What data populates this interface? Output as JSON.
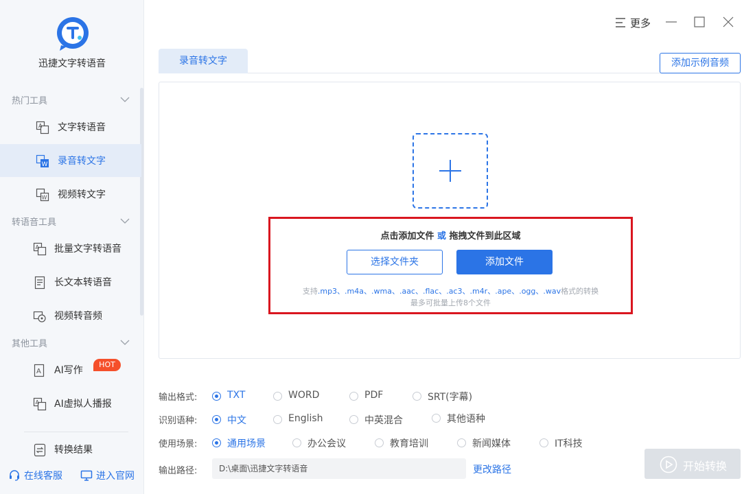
{
  "app": {
    "title": "迅捷文字转语音"
  },
  "titlebar": {
    "more_label": "更多"
  },
  "sidebar": {
    "sections": [
      {
        "title": "热门工具",
        "items": [
          {
            "label": "文字转语音",
            "icon": "text-to-speech-icon"
          },
          {
            "label": "录音转文字",
            "icon": "audio-to-text-icon",
            "active": true
          },
          {
            "label": "视频转文字",
            "icon": "video-to-text-icon"
          }
        ]
      },
      {
        "title": "转语音工具",
        "items": [
          {
            "label": "批量文字转语音",
            "icon": "batch-text-icon"
          },
          {
            "label": "长文本转语音",
            "icon": "long-text-icon"
          },
          {
            "label": "视频转音频",
            "icon": "video-audio-icon"
          }
        ]
      },
      {
        "title": "其他工具",
        "items": [
          {
            "label": "AI写作",
            "icon": "ai-write-icon",
            "badge": "HOT"
          },
          {
            "label": "AI虚拟人播报",
            "icon": "ai-avatar-icon"
          }
        ]
      }
    ],
    "result_item": {
      "label": "转换结果"
    },
    "footer": {
      "service": "在线客服",
      "website": "进入官网"
    }
  },
  "main": {
    "tab": "录音转文字",
    "sample_button": "添加示例音频",
    "drop": {
      "hint_a": "点击添加文件",
      "hint_or": "或",
      "hint_b": "拖拽文件到此区域",
      "folder_button": "选择文件夹",
      "add_button": "添加文件",
      "formats_prefix": "支持",
      "formats": ".mp3、.m4a、.wma、.aac、.flac、.ac3、.m4r、.ape、.ogg、.wav",
      "formats_suffix": "格式的转换",
      "limit": "最多可批量上传8个文件"
    },
    "options": {
      "format": {
        "label": "输出格式:",
        "choices": [
          "TXT",
          "WORD",
          "PDF",
          "SRT(字幕)"
        ],
        "selected": "TXT"
      },
      "language": {
        "label": "识别语种:",
        "choices": [
          "中文",
          "English",
          "中英混合",
          "其他语种"
        ],
        "selected": "中文"
      },
      "scene": {
        "label": "使用场景:",
        "choices": [
          "通用场景",
          "办公会议",
          "教育培训",
          "新闻媒体",
          "IT科技"
        ],
        "selected": "通用场景"
      },
      "path": {
        "label": "输出路径:",
        "value": "D:\\桌面\\迅捷文字转语音",
        "change_label": "更改路径"
      }
    },
    "start_button": "开始转换"
  },
  "colors": {
    "accent": "#2b74e6",
    "highlight": "#d9161f",
    "hot": "#f5502b"
  }
}
